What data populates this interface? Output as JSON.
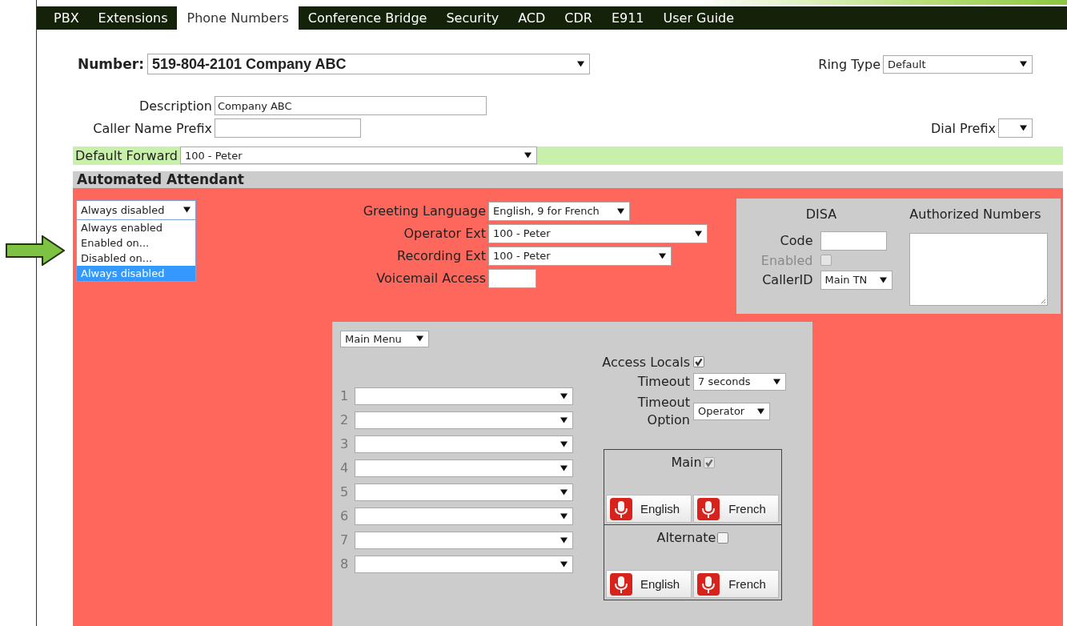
{
  "tabs": [
    {
      "label": "PBX",
      "selected": false
    },
    {
      "label": "Extensions",
      "selected": false
    },
    {
      "label": "Phone Numbers",
      "selected": true
    },
    {
      "label": "Conference Bridge",
      "selected": false
    },
    {
      "label": "Security",
      "selected": false
    },
    {
      "label": "ACD",
      "selected": false
    },
    {
      "label": "CDR",
      "selected": false
    },
    {
      "label": "E911",
      "selected": false
    },
    {
      "label": "User Guide",
      "selected": false
    }
  ],
  "number": {
    "label": "Number:",
    "value": "519-804-2101 Company ABC"
  },
  "ring_type": {
    "label": "Ring Type",
    "value": "Default"
  },
  "description": {
    "label": "Description",
    "value": "Company ABC"
  },
  "caller_name_prefix": {
    "label": "Caller Name Prefix"
  },
  "dial_prefix": {
    "label": "Dial Prefix"
  },
  "default_forward": {
    "label": "Default Forward",
    "value": "100 - Peter"
  },
  "automated_attendant": {
    "title": "Automated Attendant",
    "mode": {
      "value": "Always disabled",
      "open": true,
      "options": [
        {
          "label": "Always enabled",
          "selected": false
        },
        {
          "label": "Enabled on...",
          "selected": false
        },
        {
          "label": "Disabled on...",
          "selected": false
        },
        {
          "label": "Always disabled",
          "selected": true
        }
      ]
    },
    "fields": [
      {
        "kind": "select",
        "label": "Greeting Language",
        "value": "English, 9 for French"
      },
      {
        "kind": "select",
        "label": "Operator Ext",
        "value": "100 - Peter"
      },
      {
        "kind": "select",
        "label": "Recording Ext",
        "value": "100 - Peter"
      },
      {
        "kind": "input",
        "label": "Voicemail Access"
      }
    ],
    "disa": {
      "title": "DISA",
      "code_label": "Code",
      "enabled": {
        "label": "Enabled",
        "checked": false,
        "disabled": true
      },
      "caller_id": {
        "label": "CallerID",
        "value": "Main TN"
      },
      "authorized_numbers_label": "Authorized Numbers"
    },
    "menu": {
      "value": "Main Menu",
      "keys": [
        {
          "label": "1"
        },
        {
          "label": "2"
        },
        {
          "label": "3"
        },
        {
          "label": "4"
        },
        {
          "label": "5"
        },
        {
          "label": "6"
        },
        {
          "label": "7"
        },
        {
          "label": "8"
        }
      ],
      "access_locals": {
        "label": "Access Locals",
        "checked": true
      },
      "timeout": {
        "label": "Timeout",
        "value": "7 seconds"
      },
      "timeout_option": {
        "label": "Timeout Option",
        "value": "Operator"
      },
      "greetings": [
        {
          "label": "Main",
          "checked": true,
          "disabled": true,
          "buttons": [
            "English",
            "French"
          ]
        },
        {
          "label": "Alternate",
          "checked": false,
          "disabled": false,
          "buttons": [
            "English",
            "French"
          ]
        }
      ]
    }
  }
}
